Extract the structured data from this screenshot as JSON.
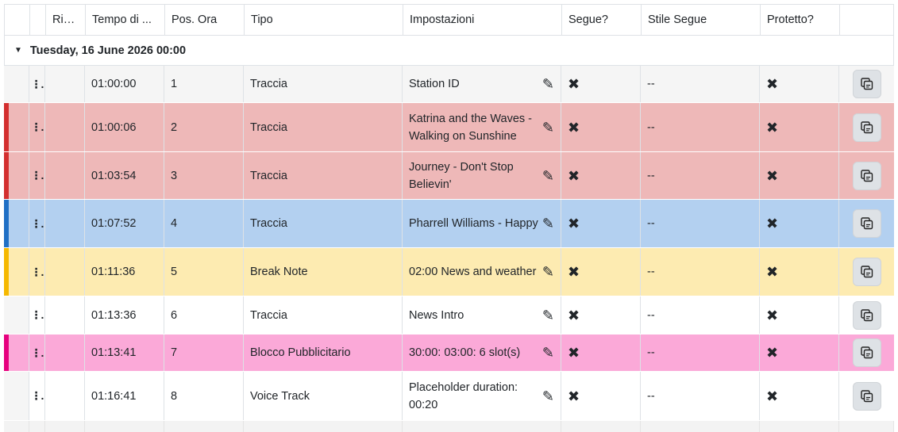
{
  "columns": [
    "",
    "",
    "Rip...",
    "Tempo di ...",
    "Pos. Ora",
    "Tipo",
    "Impostazioni",
    "Segue?",
    "Stile Segue",
    "Protetto?",
    ""
  ],
  "group": {
    "label": "Tuesday, 16 June 2026 00:00"
  },
  "colors": {
    "red": "#eeb8b8",
    "red_accent": "#d32f2f",
    "blue": "#b3d0f0",
    "blue_accent": "#1f6fc5",
    "yellow": "#fdebb1",
    "yellow_accent": "#f5b800",
    "pink": "#fba9d8",
    "pink_accent": "#e6007e",
    "gray": "#f5f5f5"
  },
  "rows": [
    {
      "time": "01:00:00",
      "pos": "1",
      "type": "Traccia",
      "settings": "Station ID",
      "segue": "✖",
      "style": "--",
      "protected": "✖"
    },
    {
      "time": "01:00:06",
      "pos": "2",
      "type": "Traccia",
      "settings": "Katrina and the Waves - Walking on Sunshine",
      "segue": "✖",
      "style": "--",
      "protected": "✖"
    },
    {
      "time": "01:03:54",
      "pos": "3",
      "type": "Traccia",
      "settings": "Journey - Don't Stop Believin'",
      "segue": "✖",
      "style": "--",
      "protected": "✖"
    },
    {
      "time": "01:07:52",
      "pos": "4",
      "type": "Traccia",
      "settings": "Pharrell Williams - Happy",
      "segue": "✖",
      "style": "--",
      "protected": "✖"
    },
    {
      "time": "01:11:36",
      "pos": "5",
      "type": "Break Note",
      "settings": "02:00 News and weather",
      "segue": "✖",
      "style": "--",
      "protected": "✖"
    },
    {
      "time": "01:13:36",
      "pos": "6",
      "type": "Traccia",
      "settings": "News Intro",
      "segue": "✖",
      "style": "--",
      "protected": "✖"
    },
    {
      "time": "01:13:41",
      "pos": "7",
      "type": "Blocco Pubblicitario",
      "settings": "30:00: 03:00: 6 slot(s)",
      "segue": "✖",
      "style": "--",
      "protected": "✖"
    },
    {
      "time": "01:16:41",
      "pos": "8",
      "type": "Voice Track",
      "settings": "Placeholder duration: 00:20",
      "segue": "✖",
      "style": "--",
      "protected": "✖"
    }
  ],
  "icons": {
    "grip": "drag-handle-icon",
    "edit": "pencil-icon",
    "segue": "x-icon",
    "copy": "copy-icon"
  }
}
